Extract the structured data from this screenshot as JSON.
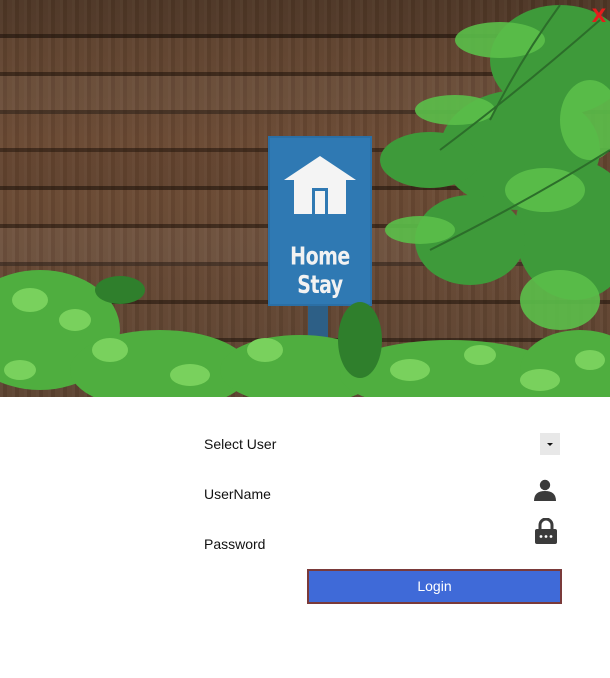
{
  "window": {
    "close_symbol": "X",
    "close_color": "#e51c1c"
  },
  "hero": {
    "sign_text": "Home Stay",
    "sign_icon": "house-icon"
  },
  "form": {
    "select_user_label": "Select User",
    "username_label": "UserName",
    "password_label": "Password",
    "select_user_value": "",
    "username_value": "",
    "password_value": "",
    "username_icon": "user-icon",
    "password_icon": "lock-icon"
  },
  "login_button": {
    "label": "Login",
    "color": "#3f6ad8"
  }
}
